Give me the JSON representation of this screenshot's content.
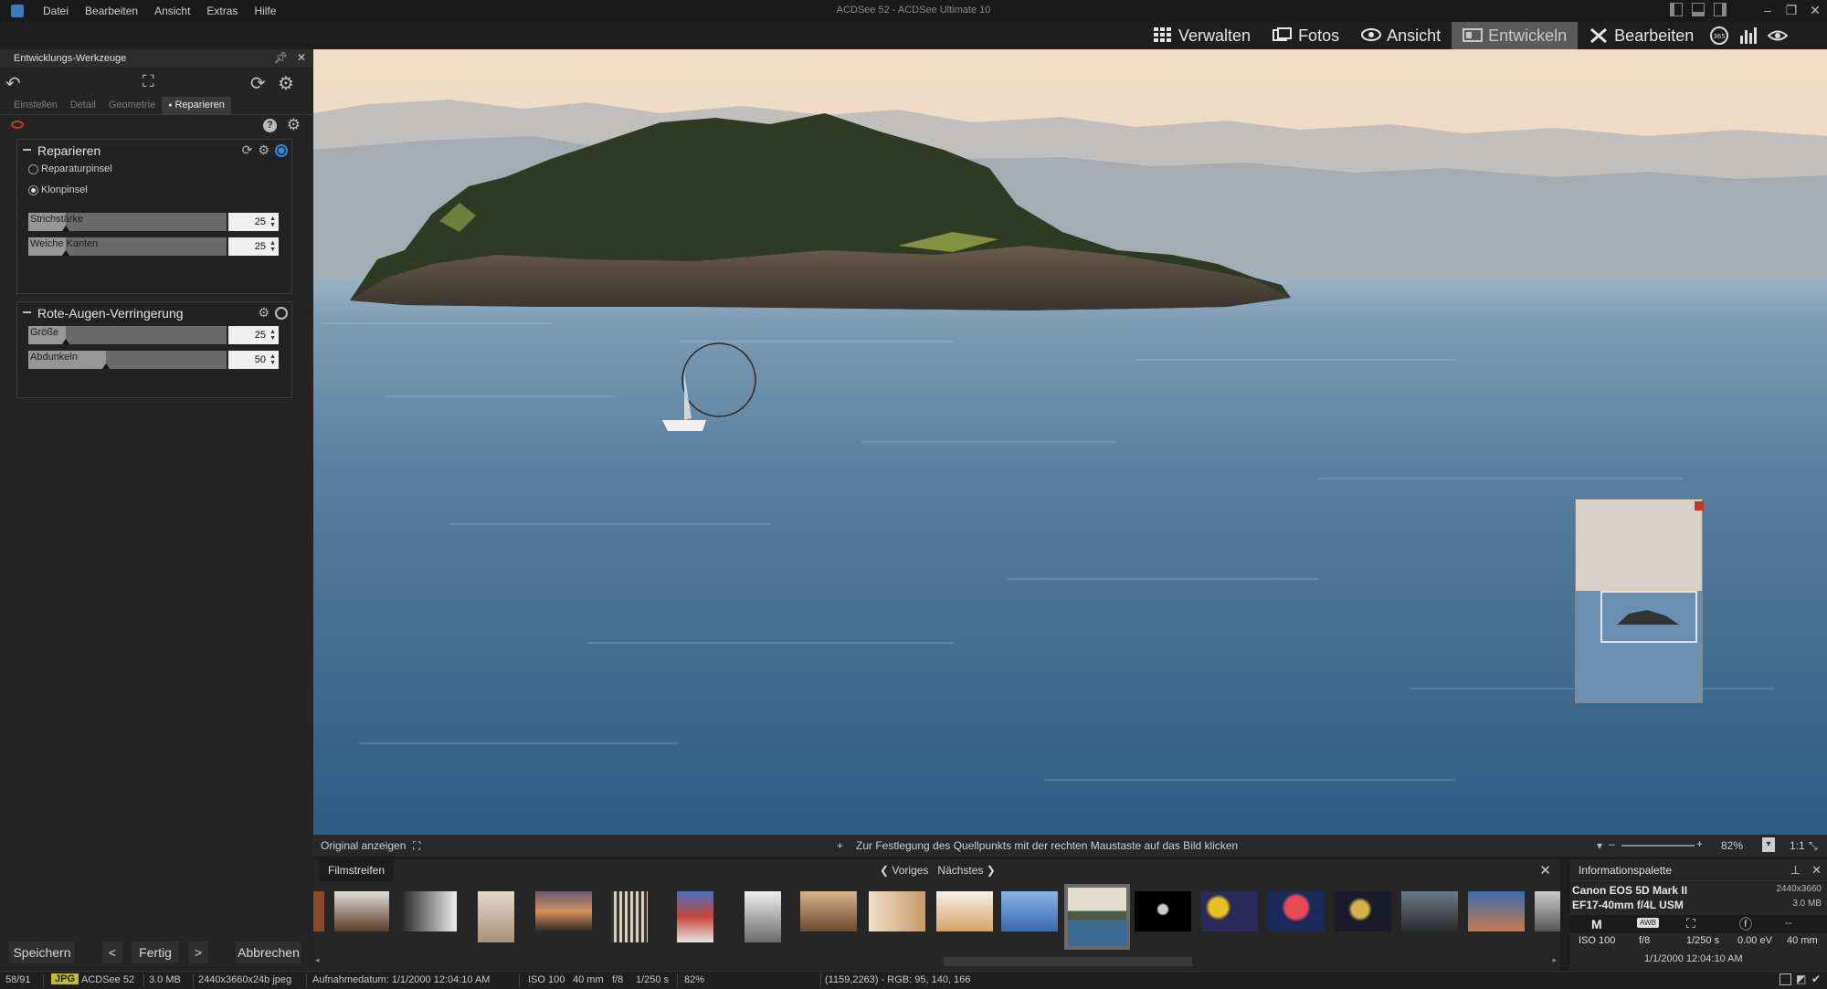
{
  "window": {
    "title": "ACDSee 52 - ACDSee Ultimate 10",
    "menu": [
      "Datei",
      "Bearbeiten",
      "Ansicht",
      "Extras",
      "Hilfe"
    ]
  },
  "modes": {
    "verwalten": "Verwalten",
    "fotos": "Fotos",
    "ansicht": "Ansicht",
    "entwickeln": "Entwickeln",
    "bearbeiten": "Bearbeiten",
    "active": "Entwickeln"
  },
  "left_panel": {
    "title": "Entwicklungs-Werkzeuge",
    "tabs": [
      "Einstellen",
      "Detail",
      "Geometrie",
      "Reparieren"
    ],
    "active_tab": "Reparieren",
    "repair": {
      "title": "Reparieren",
      "options": [
        "Reparaturpinsel",
        "Klonpinsel"
      ],
      "selected_option": "Klonpinsel",
      "sliders": [
        {
          "label": "Strichstärke",
          "value": "25",
          "level": 0.19
        },
        {
          "label": "Weiche Kanten",
          "value": "25",
          "level": 0.19
        }
      ]
    },
    "redeye": {
      "title": "Rote-Augen-Verringerung",
      "sliders": [
        {
          "label": "Größe",
          "value": "25",
          "level": 0.19
        },
        {
          "label": "Abdunkeln",
          "value": "50",
          "level": 0.39
        }
      ]
    },
    "buttons": {
      "save": "Speichern",
      "done": "Fertig",
      "cancel": "Abbrechen"
    }
  },
  "viewer_bar": {
    "show_original": "Original anzeigen",
    "hint": "Zur Festlegung des Quellpunkts mit der rechten Maustaste auf das Bild klicken",
    "zoom": "82%",
    "one_to_one": "1:1"
  },
  "filmstrip": {
    "title": "Filmstreifen",
    "prev": "Voriges",
    "next": "Nächstes"
  },
  "info_palette": {
    "title": "Informationspalette",
    "camera": "Canon EOS 5D Mark II",
    "lens": "EF17-40mm f/4L USM",
    "dimensions": "2440x3660",
    "size": "3.0 MB",
    "mode": "M",
    "wb": "AWB",
    "iso": "ISO 100",
    "aperture": "f/8",
    "shutter": "1/250 s",
    "ev": "0.00 eV",
    "focal": "40 mm",
    "dash": "--",
    "date": "1/1/2000 12:04:10 AM"
  },
  "statusbar": {
    "index": "58/91",
    "type": "JPG",
    "name": "ACDSee 52",
    "filesize": "3.0 MB",
    "dims": "2440x3660x24b jpeg",
    "date": "Aufnahmedatum: 1/1/2000 12:04:10 AM",
    "iso": "ISO 100",
    "focal": "40 mm",
    "aperture": "f/8",
    "shutter": "1/250 s",
    "zoom": "82%",
    "pixel": "(1159,2263) - RGB: 95, 140, 166"
  }
}
